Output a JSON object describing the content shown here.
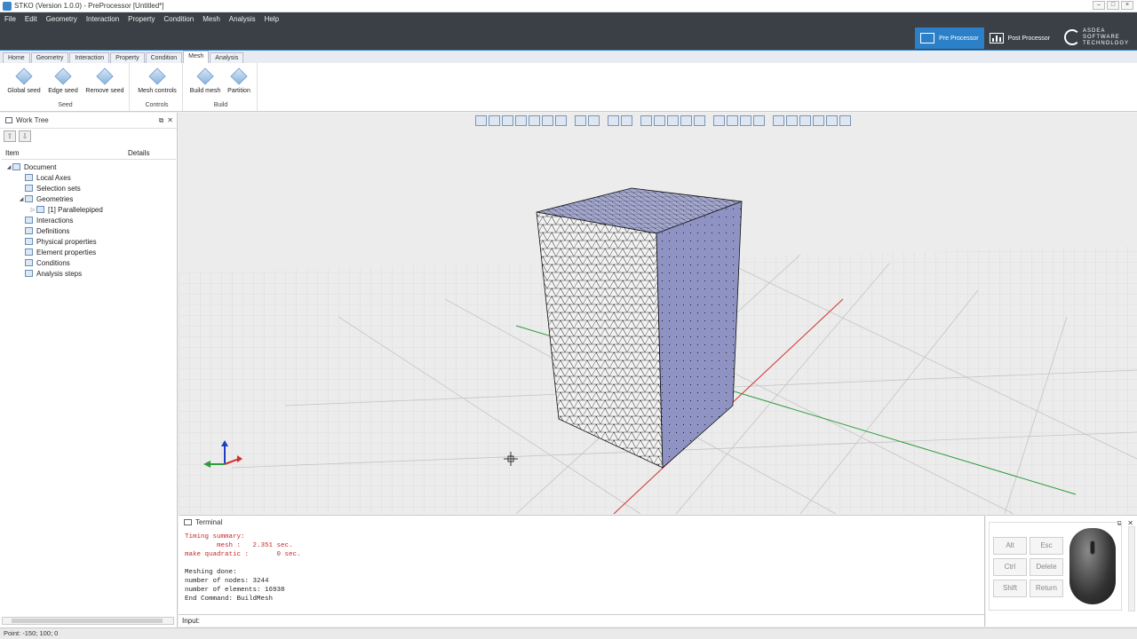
{
  "window": {
    "title": "STKO (Version 1.0.0) - PreProcessor [Untitled*]",
    "controls": [
      "–",
      "□",
      "×"
    ]
  },
  "menu": [
    "File",
    "Edit",
    "Geometry",
    "Interaction",
    "Property",
    "Condition",
    "Mesh",
    "Analysis",
    "Help"
  ],
  "processors": {
    "pre": "Pre Processor",
    "post": "Post Processor"
  },
  "logo": {
    "line1": "ASDEA",
    "line2": "SOFTWARE",
    "line3": "TECHNOLOGY"
  },
  "ribbon": {
    "tabs": [
      "Home",
      "Geometry",
      "Interaction",
      "Property",
      "Condition",
      "Mesh",
      "Analysis"
    ],
    "active_tab": "Mesh",
    "groups": [
      {
        "label": "Seed",
        "buttons": [
          "Global seed",
          "Edge seed",
          "Remove seed"
        ]
      },
      {
        "label": "Controls",
        "buttons": [
          "Mesh controls"
        ]
      },
      {
        "label": "Build",
        "buttons": [
          "Build mesh",
          "Partition"
        ]
      }
    ]
  },
  "worktree": {
    "title": "Work Tree",
    "col_item": "Item",
    "col_details": "Details",
    "nodes": [
      {
        "label": "Document",
        "expander": "◢"
      },
      {
        "label": "Local Axes",
        "expander": ""
      },
      {
        "label": "Selection sets",
        "expander": ""
      },
      {
        "label": "Geometries",
        "expander": "◢"
      },
      {
        "label": "[1] Parallelepiped",
        "expander": "▷"
      },
      {
        "label": "Interactions",
        "expander": ""
      },
      {
        "label": "Definitions",
        "expander": ""
      },
      {
        "label": "Physical properties",
        "expander": ""
      },
      {
        "label": "Element properties",
        "expander": ""
      },
      {
        "label": "Conditions",
        "expander": ""
      },
      {
        "label": "Analysis steps",
        "expander": ""
      }
    ]
  },
  "terminal": {
    "title": "Terminal",
    "lines": [
      {
        "text": "Timing summary:",
        "color": "red"
      },
      {
        "text": "        mesh :   2.351 sec.",
        "color": "red"
      },
      {
        "text": "make quadratic :       0 sec.",
        "color": "red"
      },
      {
        "text": "",
        "color": "black"
      },
      {
        "text": "Meshing done:",
        "color": "black"
      },
      {
        "text": "number of nodes: 3244",
        "color": "black"
      },
      {
        "text": "number of elements: 16938",
        "color": "black"
      },
      {
        "text": "End Command: BuildMesh",
        "color": "black"
      }
    ],
    "input_label": "Input:",
    "input_value": ""
  },
  "keys": {
    "alt": "Alt",
    "esc": "Esc",
    "ctrl": "Ctrl",
    "delete": "Delete",
    "shift": "Shift",
    "return": "Return"
  },
  "status": {
    "point": "Point: -150; 100; 0"
  },
  "colors": {
    "accent": "#2c80c8",
    "header": "#3b4046",
    "box_side": "#8e93c4",
    "box_front": "#f3f3f3",
    "axis_x": "#d32f2f",
    "axis_y": "#2e9b3e",
    "axis_z": "#1f3fbf"
  },
  "icons": {
    "app": "stko-icon",
    "pre_processor": "monitor-icon",
    "post_processor": "chart-icon",
    "mouse": "mouse-icon"
  }
}
